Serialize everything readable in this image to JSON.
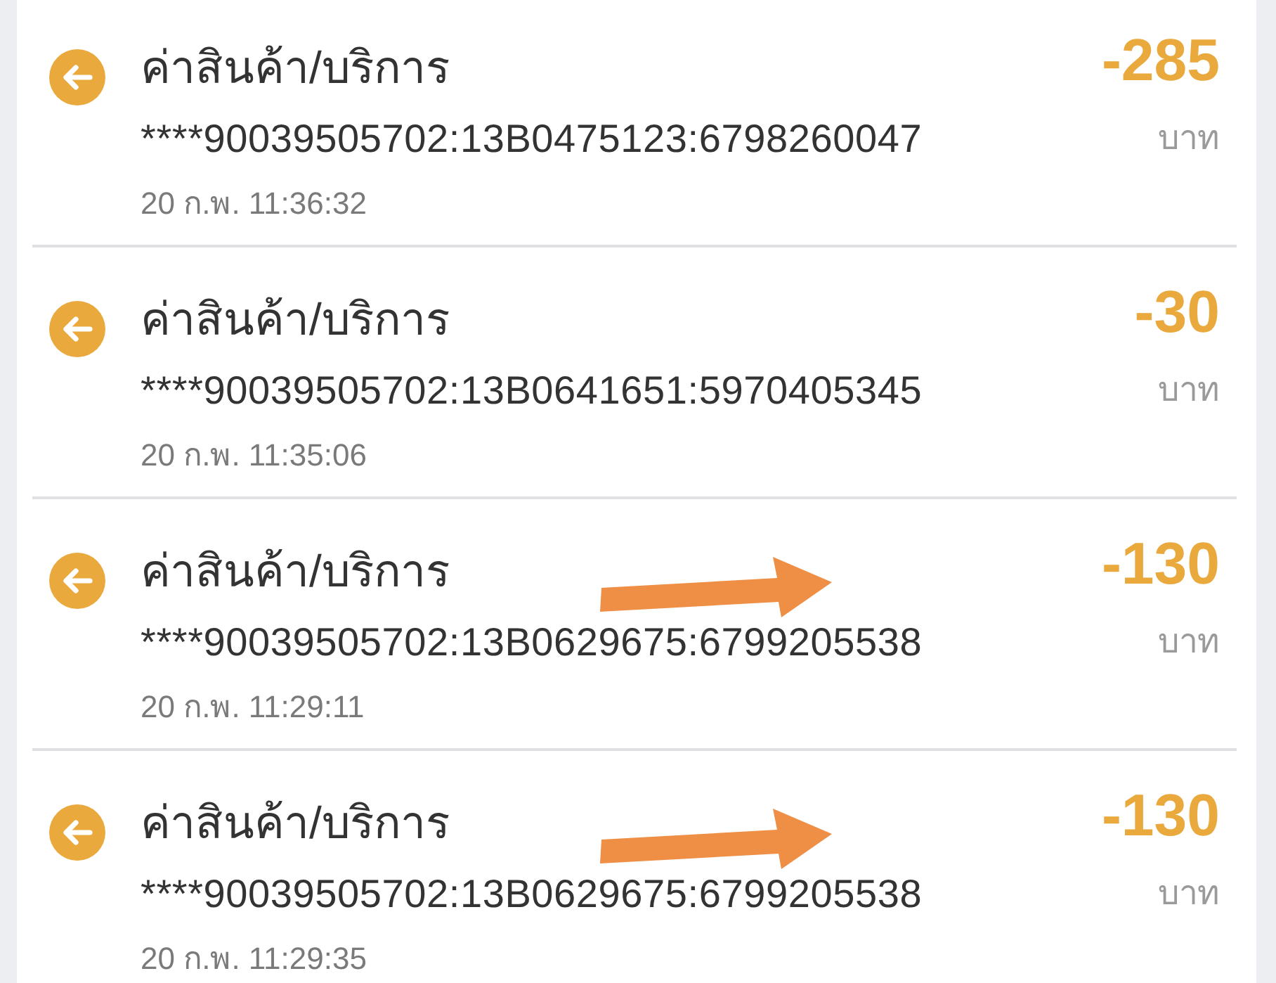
{
  "transactions": [
    {
      "title": "ค่าสินค้า/บริการ",
      "reference": "****90039505702:13B0475123:6798260047",
      "datetime": "20 ก.พ. 11:36:32",
      "amount": "-285",
      "currency": "บาท",
      "annotated": false
    },
    {
      "title": "ค่าสินค้า/บริการ",
      "reference": "****90039505702:13B0641651:5970405345",
      "datetime": "20 ก.พ. 11:35:06",
      "amount": "-30",
      "currency": "บาท",
      "annotated": false
    },
    {
      "title": "ค่าสินค้า/บริการ",
      "reference": "****90039505702:13B0629675:6799205538",
      "datetime": "20 ก.พ. 11:29:11",
      "amount": "-130",
      "currency": "บาท",
      "annotated": true
    },
    {
      "title": "ค่าสินค้า/บริการ",
      "reference": "****90039505702:13B0629675:6799205538",
      "datetime": "20 ก.พ. 11:29:35",
      "amount": "-130",
      "currency": "บาท",
      "annotated": true
    }
  ]
}
